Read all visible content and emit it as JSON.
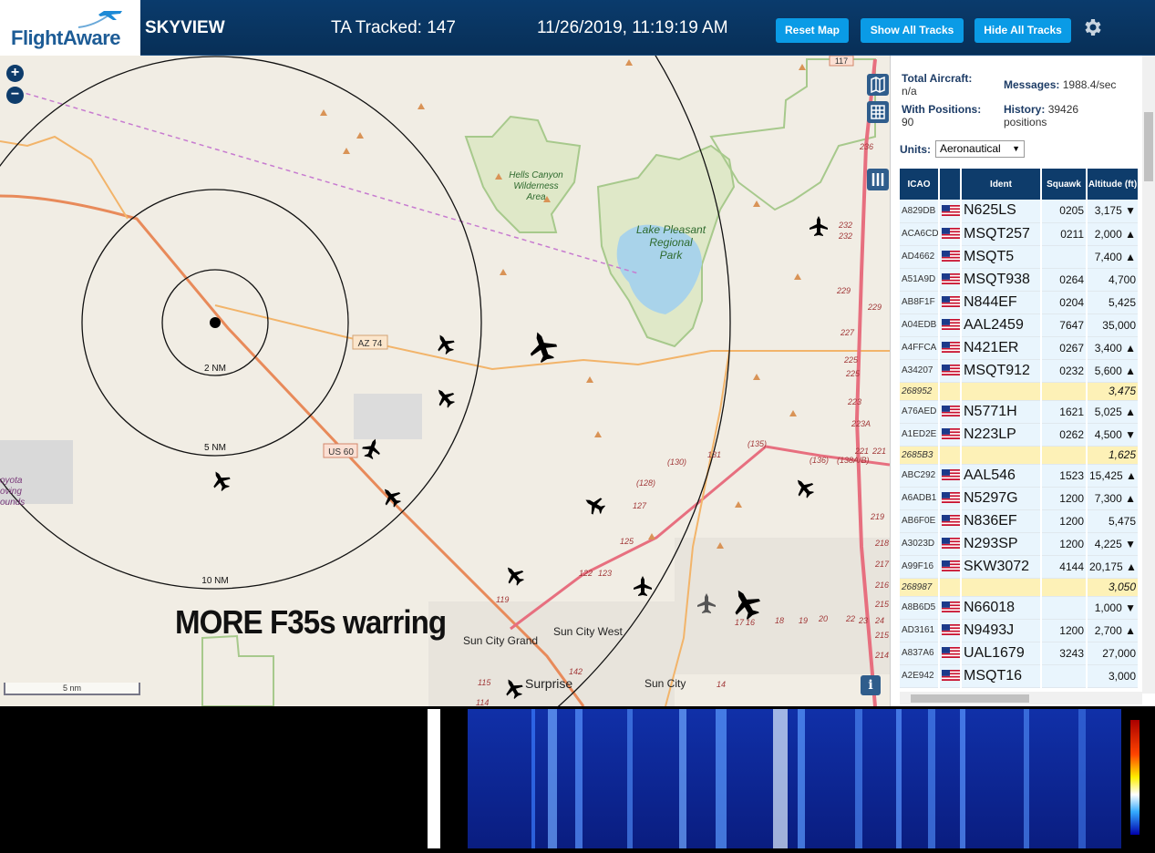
{
  "header": {
    "logo_text": "FlightAware",
    "app_title": "SKYVIEW",
    "tracked": "TA Tracked: 147",
    "datetime": "11/26/2019, 11:19:19 AM",
    "buttons": {
      "reset": "Reset Map",
      "show": "Show All Tracks",
      "hide": "Hide All Tracks"
    }
  },
  "map": {
    "overlay_text": "MORE F35s warring",
    "zoom_in": "+",
    "zoom_out": "−",
    "scale_label": "5 nm",
    "info": "i",
    "range_labels": [
      "2 NM",
      "5 NM",
      "10 NM"
    ],
    "place_labels": {
      "hells_canyon": [
        "Hells Canyon",
        "Wilderness",
        "Area"
      ],
      "lake_pleasant": [
        "Lake Pleasant",
        "Regional",
        "Park"
      ],
      "sun_city_west": "Sun City West",
      "sun_city_grand": "Sun City Grand",
      "surprise": "Surprise",
      "sun_city": "Sun City",
      "coyota": [
        "oyota",
        "oving",
        "ounds"
      ]
    },
    "road_labels": {
      "az74": "AZ 74",
      "us60": "US 60",
      "r117": "117",
      "r135": "(135)",
      "r130": "(130)",
      "r131": "131",
      "r128": "(128)",
      "r127": "127",
      "r136": "(136)",
      "r138": "(138A/B)",
      "r125": "125",
      "r123": "123",
      "r122": "122",
      "r119": "119",
      "r115": "115",
      "r114": "114",
      "r142": "142",
      "mile_markers": [
        "236",
        "232",
        "232",
        "229",
        "229",
        "227",
        "225",
        "225",
        "223",
        "223A",
        "221",
        "221",
        "219",
        "218",
        "217",
        "216",
        "215",
        "214",
        "14",
        "16",
        "17",
        "18",
        "19",
        "20",
        "22",
        "23",
        "24",
        "215"
      ]
    }
  },
  "panel": {
    "total_aircraft_label": "Total Aircraft:",
    "total_aircraft_value": "n/a",
    "with_positions_label": "With Positions:",
    "with_positions_value": "90",
    "messages_label": "Messages:",
    "messages_value": "1988.4/sec",
    "history_label": "History:",
    "history_value": "39426",
    "history_unit": "positions",
    "units_label": "Units:",
    "units_value": "Aeronautical",
    "columns": [
      "ICAO",
      "Ident",
      "Squawk",
      "Altitude (ft)"
    ],
    "rows": [
      {
        "icao": "A829DB",
        "flag": true,
        "ident": "N625LS",
        "squawk": "0205",
        "alt": "3,175 ▼"
      },
      {
        "icao": "ACA6CD",
        "flag": true,
        "ident": "MSQT257",
        "squawk": "0211",
        "alt": "2,000 ▲"
      },
      {
        "icao": "AD4662",
        "flag": true,
        "ident": "MSQT5",
        "squawk": "",
        "alt": "7,400 ▲"
      },
      {
        "icao": "A51A9D",
        "flag": true,
        "ident": "MSQT938",
        "squawk": "0264",
        "alt": "4,700"
      },
      {
        "icao": "AB8F1F",
        "flag": true,
        "ident": "N844EF",
        "squawk": "0204",
        "alt": "5,425"
      },
      {
        "icao": "A04EDB",
        "flag": true,
        "ident": "AAL2459",
        "squawk": "7647",
        "alt": "35,000"
      },
      {
        "icao": "A4FFCA",
        "flag": true,
        "ident": "N421ER",
        "squawk": "0267",
        "alt": "3,400 ▲"
      },
      {
        "icao": "A34207",
        "flag": true,
        "ident": "MSQT912",
        "squawk": "0232",
        "alt": "5,600 ▲"
      },
      {
        "icao": "268952",
        "flag": false,
        "ident": "",
        "squawk": "",
        "alt": "3,475"
      },
      {
        "icao": "A76AED",
        "flag": true,
        "ident": "N5771H",
        "squawk": "1621",
        "alt": "5,025 ▲"
      },
      {
        "icao": "A1ED2E",
        "flag": true,
        "ident": "N223LP",
        "squawk": "0262",
        "alt": "4,500 ▼"
      },
      {
        "icao": "2685B3",
        "flag": false,
        "ident": "",
        "squawk": "",
        "alt": "1,625"
      },
      {
        "icao": "ABC292",
        "flag": true,
        "ident": "AAL546",
        "squawk": "1523",
        "alt": "15,425 ▲"
      },
      {
        "icao": "A6ADB1",
        "flag": true,
        "ident": "N5297G",
        "squawk": "1200",
        "alt": "7,300 ▲"
      },
      {
        "icao": "AB6F0E",
        "flag": true,
        "ident": "N836EF",
        "squawk": "1200",
        "alt": "5,475"
      },
      {
        "icao": "A3023D",
        "flag": true,
        "ident": "N293SP",
        "squawk": "1200",
        "alt": "4,225 ▼"
      },
      {
        "icao": "A99F16",
        "flag": true,
        "ident": "SKW3072",
        "squawk": "4144",
        "alt": "20,175 ▲"
      },
      {
        "icao": "268987",
        "flag": false,
        "ident": "",
        "squawk": "",
        "alt": "3,050"
      },
      {
        "icao": "A8B6D5",
        "flag": true,
        "ident": "N66018",
        "squawk": "",
        "alt": "1,000 ▼"
      },
      {
        "icao": "AD3161",
        "flag": true,
        "ident": "N9493J",
        "squawk": "1200",
        "alt": "2,700 ▲"
      },
      {
        "icao": "A837A6",
        "flag": true,
        "ident": "UAL1679",
        "squawk": "3243",
        "alt": "27,000"
      },
      {
        "icao": "A2E942",
        "flag": true,
        "ident": "MSQT16",
        "squawk": "",
        "alt": "3,000"
      }
    ]
  },
  "colors": {
    "header_bg": "#0a3b6c",
    "button_bg": "#0a9be6",
    "table_header": "#0e3c6b",
    "row_bg": "#e9f5fd",
    "row_noflag_bg": "#fdf1b7",
    "map_bg": "#f1ede4"
  },
  "icons": [
    "flightaware-logo-plane",
    "gear-icon",
    "zoom-in-icon",
    "zoom-out-icon",
    "map-layer-icon",
    "grid-icon",
    "columns-icon",
    "info-icon",
    "aircraft-icon",
    "us-flag-icon"
  ]
}
